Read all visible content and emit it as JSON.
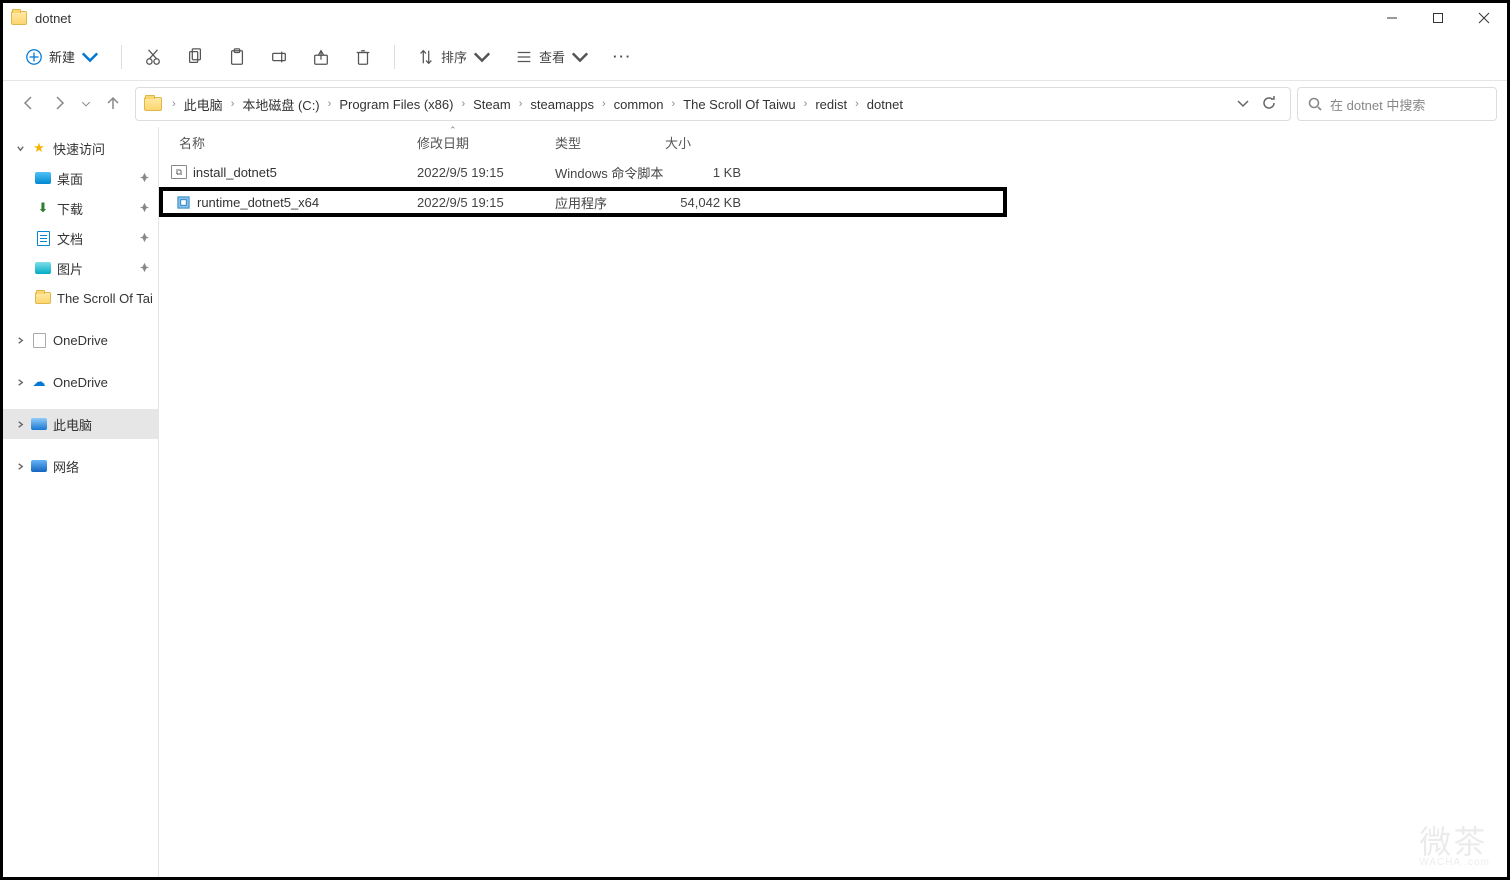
{
  "window": {
    "title": "dotnet"
  },
  "toolbar": {
    "new": "新建",
    "sort": "排序",
    "view": "查看"
  },
  "breadcrumb": [
    "此电脑",
    "本地磁盘 (C:)",
    "Program Files (x86)",
    "Steam",
    "steamapps",
    "common",
    "The Scroll Of Taiwu",
    "redist",
    "dotnet"
  ],
  "search": {
    "placeholder": "在 dotnet 中搜索"
  },
  "sidebar": {
    "quick": "快速访问",
    "items": [
      "桌面",
      "下载",
      "文档",
      "图片",
      "The Scroll Of Tai"
    ],
    "onedrive1": "OneDrive",
    "onedrive2": "OneDrive",
    "thispc": "此电脑",
    "network": "网络"
  },
  "columns": {
    "name": "名称",
    "date": "修改日期",
    "type": "类型",
    "size": "大小"
  },
  "files": [
    {
      "name": "install_dotnet5",
      "date": "2022/9/5 19:15",
      "type": "Windows 命令脚本",
      "size": "1 KB",
      "kind": "cmd",
      "selected": false
    },
    {
      "name": "runtime_dotnet5_x64",
      "date": "2022/9/5 19:15",
      "type": "应用程序",
      "size": "54,042 KB",
      "kind": "exe",
      "selected": true
    }
  ],
  "watermark": {
    "main": "微茶",
    "sub": "WACHA\n.com"
  }
}
